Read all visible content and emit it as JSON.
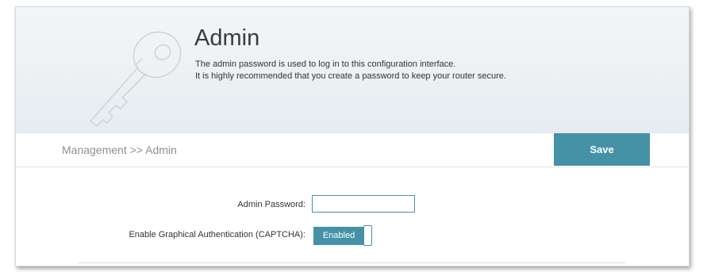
{
  "header": {
    "title": "Admin",
    "description_line1": "The admin password is used to log in to this configuration interface.",
    "description_line2": "It is highly recommended that you create a password to keep your router secure.",
    "icon": "key-icon"
  },
  "breadcrumb": "Management >> Admin",
  "toolbar": {
    "save_label": "Save"
  },
  "form": {
    "admin_password": {
      "label": "Admin Password:",
      "value": ""
    },
    "captcha": {
      "label": "Enable Graphical Authentication (CAPTCHA):",
      "state_label": "Enabled"
    }
  },
  "colors": {
    "accent": "#4592a6",
    "header_bg": "#e9eef1"
  }
}
